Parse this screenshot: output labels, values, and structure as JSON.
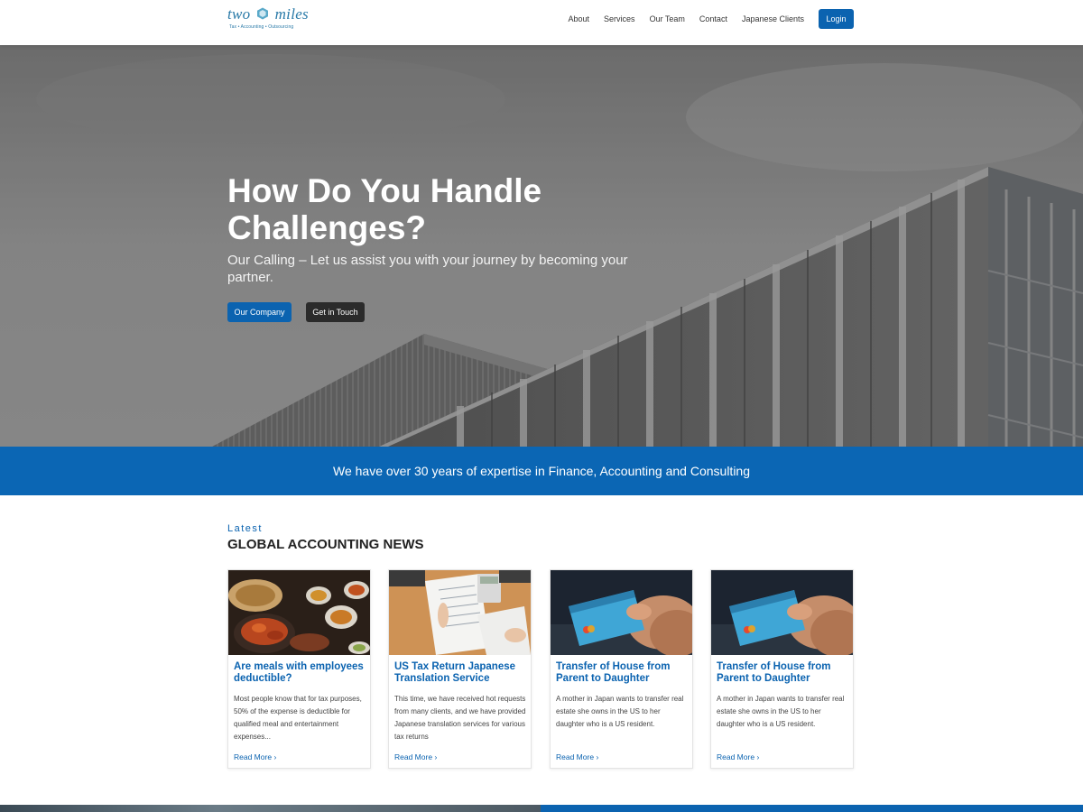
{
  "header": {
    "logo_text_left": "two",
    "logo_text_right": "miles",
    "logo_tagline": "Tax • Accounting • Outsourcing",
    "nav": [
      "About",
      "Services",
      "Our Team",
      "Contact",
      "Japanese Clients"
    ],
    "login_label": "Login"
  },
  "hero": {
    "title": "How Do You Handle Challenges?",
    "subtitle": "Our Calling – Let us assist you with your journey by becoming your partner.",
    "primary_button": "Our Company",
    "secondary_button": "Get in Touch"
  },
  "band": {
    "text": "We have over 30 years of expertise in Finance, Accounting and Consulting"
  },
  "news": {
    "kicker": "Latest",
    "title": "GLOBAL ACCOUNTING NEWS",
    "read_more": "Read More",
    "cards": [
      {
        "title": "Are meals with employees deductible?",
        "text": "Most people know that for tax purposes, 50% of the expense is deductible for qualified meal and entertainment expenses...",
        "image": "food-photo"
      },
      {
        "title": "US Tax Return Japanese Translation Service",
        "text": "This time, we have received hot requests from many clients, and we have provided Japanese translation services for various tax returns",
        "image": "documents-photo"
      },
      {
        "title": "Transfer of House from Parent to Daughter",
        "text": "A mother in Japan wants to transfer real estate she owns in the US to her daughter who is a US resident.",
        "image": "credit-card-photo"
      },
      {
        "title": "Transfer of House from Parent to Daughter",
        "text": "A mother in Japan wants to transfer real estate she owns in the US to her daughter who is a US resident.",
        "image": "credit-card-photo"
      }
    ]
  },
  "colors": {
    "brand_blue": "#0b63b0",
    "dark_button": "#2b2b2b",
    "band_blue": "#0b66b4"
  }
}
